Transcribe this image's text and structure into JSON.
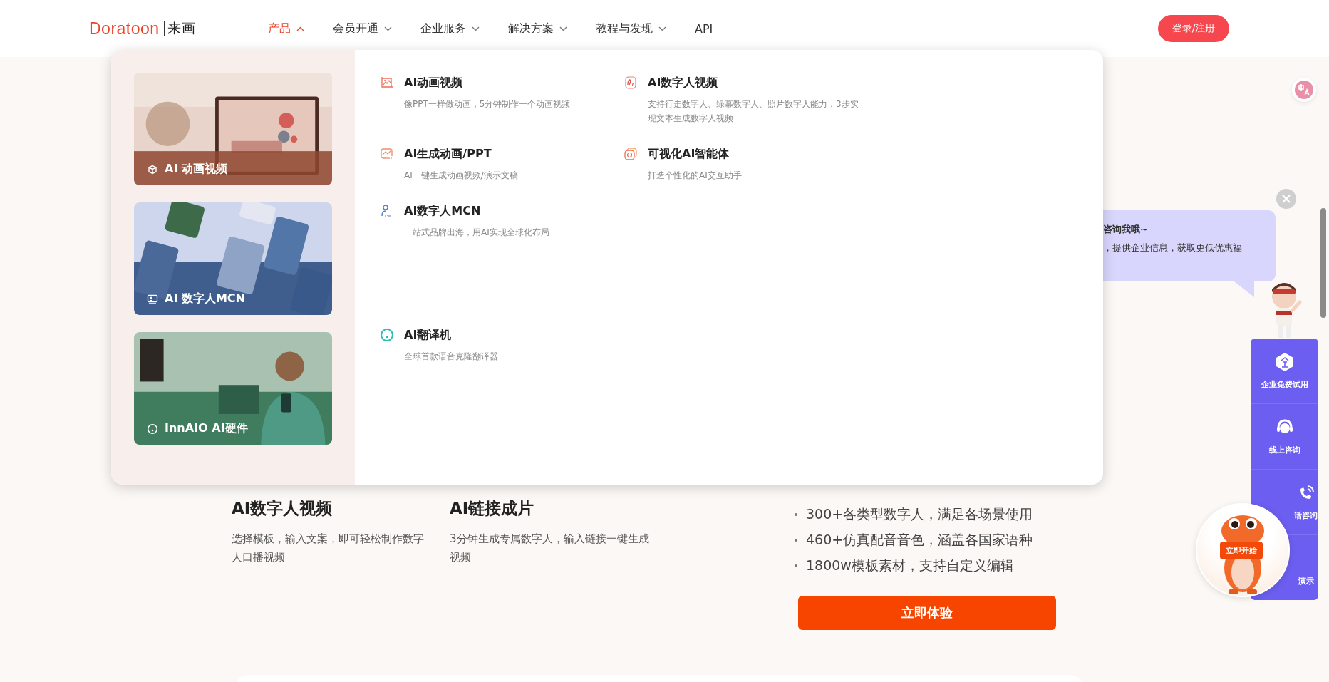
{
  "header": {
    "logo": {
      "name": "Doratoon",
      "cn": "来画"
    },
    "nav": [
      {
        "label": "产品",
        "selected": true,
        "caret": true
      },
      {
        "label": "会员开通",
        "selected": false,
        "caret": true
      },
      {
        "label": "企业服务",
        "selected": false,
        "caret": true
      },
      {
        "label": "解决方案",
        "selected": false,
        "caret": true
      },
      {
        "label": "教程与发现",
        "selected": false,
        "caret": true
      },
      {
        "label": "API",
        "selected": false,
        "caret": false
      }
    ],
    "login": "登录/注册"
  },
  "dropdown": {
    "cards": [
      {
        "label": "AI 动画视频",
        "kind": "picture"
      },
      {
        "label": "AI 数字人MCN",
        "kind": "picture"
      },
      {
        "label": "InnAIO AI硬件",
        "kind": "picture"
      }
    ],
    "items": [
      {
        "title": "AI动画视频",
        "desc": "像PPT一样做动画，5分钟制作一个动画视频"
      },
      {
        "title": "AI数字人视频",
        "desc": "支持行走数字人、绿幕数字人、照片数字人能力，3步实现文本生成数字人视频"
      },
      {
        "title": "AI生成动画/PPT",
        "desc": "AI一键生成动画视频/演示文稿"
      },
      {
        "title": "可视化AI智能体",
        "desc": "打造个性化的AI交互助手"
      },
      {
        "title": "AI数字人MCN",
        "desc": "一站式品牌出海，用AI实现全球化布局"
      }
    ],
    "extra_items": [
      {
        "title": "AI翻译机",
        "desc": "全球首款语音克隆翻译器"
      }
    ]
  },
  "features": [
    {
      "title": "AI数字人视频",
      "desc": "选择模板，输入文案，即可轻松制作数字人口播视频"
    },
    {
      "title": "AI链接成片",
      "desc": "3分钟生成专属数字人，输入链接一键生成视频"
    }
  ],
  "bullets": [
    "300+各类型数字人，满足各场景使用",
    "460+仿真配音音色，涵盖各国家语种",
    "1800w模板素材，支持自定义编辑"
  ],
  "cta": "立即体验",
  "chat_bubble": {
    "title": "咨询我哦~",
    "text": "，提供企业信息，获取更低优惠福"
  },
  "side_panel": [
    {
      "label": "企业免费试用",
      "covered": false
    },
    {
      "label": "线上咨询",
      "covered": false
    },
    {
      "label": "话咨询",
      "covered": true
    },
    {
      "label": "演示",
      "covered": true
    }
  ],
  "start_badge": "立即开始"
}
